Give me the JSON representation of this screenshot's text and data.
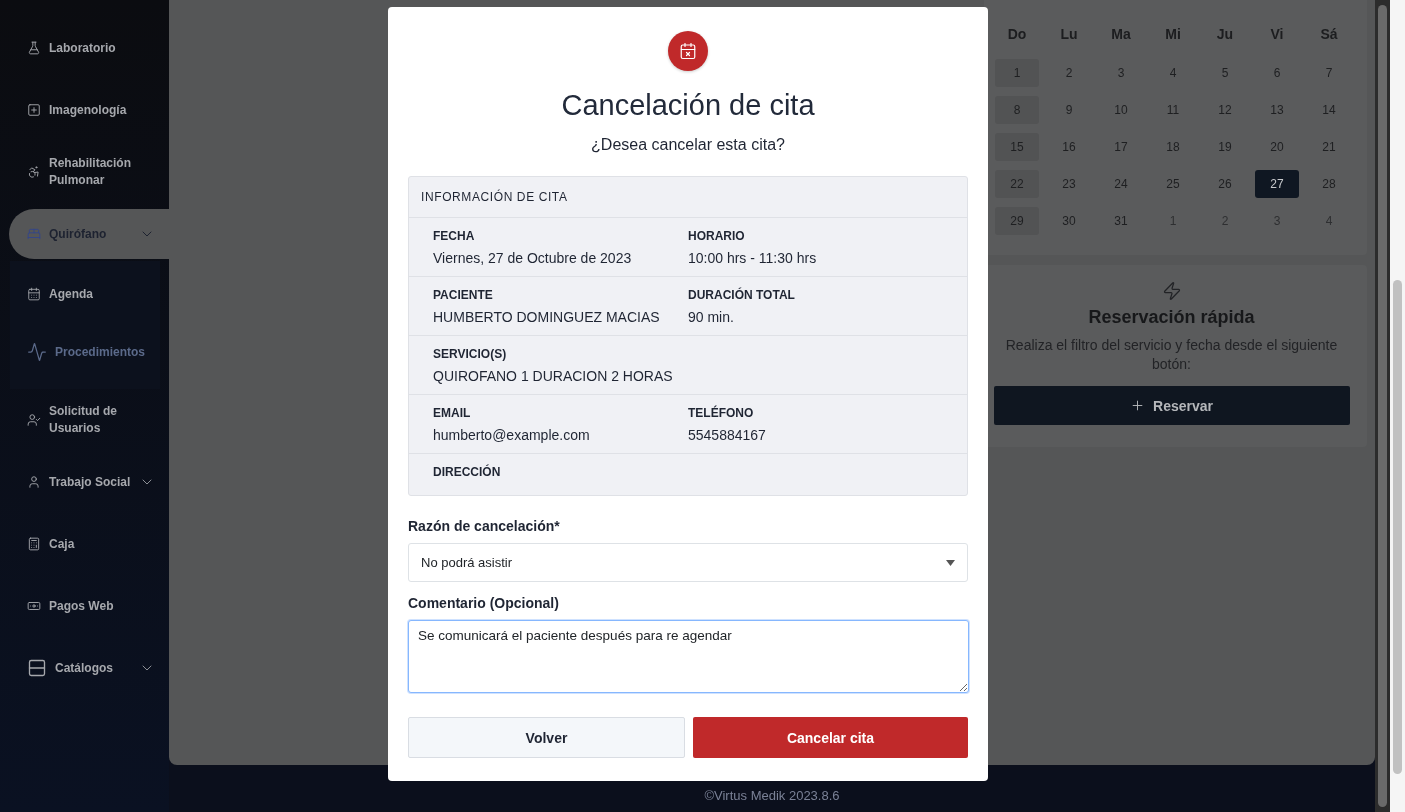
{
  "sidebar": {
    "items": [
      {
        "label": "Laboratorio",
        "selected": false
      },
      {
        "label": "Imagenología",
        "selected": false
      },
      {
        "label": "Rehabilitación Pulmonar",
        "selected": false
      },
      {
        "label": "Quirófano",
        "selected": true,
        "expanded": true,
        "children": [
          {
            "label": "Agenda",
            "selected": false
          },
          {
            "label": "Procedimientos",
            "selected": true
          }
        ]
      },
      {
        "label": "Solicitud de Usuarios",
        "selected": false
      },
      {
        "label": "Trabajo Social",
        "selected": false,
        "expanded": false
      },
      {
        "label": "Caja",
        "selected": false
      },
      {
        "label": "Pagos Web",
        "selected": false
      },
      {
        "label": "Catálogos",
        "selected": false,
        "expanded": false
      }
    ]
  },
  "calendar": {
    "weekdays": [
      "Do",
      "Lu",
      "Ma",
      "Mi",
      "Ju",
      "Vi",
      "Sá"
    ],
    "weeks": [
      [
        {
          "day": "1",
          "selected": false,
          "outside_month": false
        },
        {
          "day": "2",
          "selected": false,
          "outside_month": false
        },
        {
          "day": "3",
          "selected": false,
          "outside_month": false
        },
        {
          "day": "4",
          "selected": false,
          "outside_month": false
        },
        {
          "day": "5",
          "selected": false,
          "outside_month": false
        },
        {
          "day": "6",
          "selected": false,
          "outside_month": false
        },
        {
          "day": "7",
          "selected": false,
          "outside_month": false
        }
      ],
      [
        {
          "day": "8",
          "selected": false,
          "outside_month": false
        },
        {
          "day": "9",
          "selected": false,
          "outside_month": false
        },
        {
          "day": "10",
          "selected": false,
          "outside_month": false
        },
        {
          "day": "11",
          "selected": false,
          "outside_month": false
        },
        {
          "day": "12",
          "selected": false,
          "outside_month": false
        },
        {
          "day": "13",
          "selected": false,
          "outside_month": false
        },
        {
          "day": "14",
          "selected": false,
          "outside_month": false
        }
      ],
      [
        {
          "day": "15",
          "selected": false,
          "outside_month": false
        },
        {
          "day": "16",
          "selected": false,
          "outside_month": false
        },
        {
          "day": "17",
          "selected": false,
          "outside_month": false
        },
        {
          "day": "18",
          "selected": false,
          "outside_month": false
        },
        {
          "day": "19",
          "selected": false,
          "outside_month": false
        },
        {
          "day": "20",
          "selected": false,
          "outside_month": false
        },
        {
          "day": "21",
          "selected": false,
          "outside_month": false
        }
      ],
      [
        {
          "day": "22",
          "selected": false,
          "outside_month": false
        },
        {
          "day": "23",
          "selected": false,
          "outside_month": false
        },
        {
          "day": "24",
          "selected": false,
          "outside_month": false
        },
        {
          "day": "25",
          "selected": false,
          "outside_month": false
        },
        {
          "day": "26",
          "selected": false,
          "outside_month": false
        },
        {
          "day": "27",
          "selected": true,
          "outside_month": false
        },
        {
          "day": "28",
          "selected": false,
          "outside_month": false
        }
      ],
      [
        {
          "day": "29",
          "selected": false,
          "outside_month": false
        },
        {
          "day": "30",
          "selected": false,
          "outside_month": false
        },
        {
          "day": "31",
          "selected": false,
          "outside_month": false
        },
        {
          "day": "1",
          "selected": false,
          "outside_month": true
        },
        {
          "day": "2",
          "selected": false,
          "outside_month": true
        },
        {
          "day": "3",
          "selected": false,
          "outside_month": true
        },
        {
          "day": "4",
          "selected": false,
          "outside_month": true
        }
      ]
    ]
  },
  "quick_booking": {
    "title": "Reservación rápida",
    "text": "Realiza el filtro del servicio y fecha desde el siguiente botón:",
    "button": "Reservar"
  },
  "footer": {
    "text": "©Virtus Medik 2023.8.6"
  },
  "modal": {
    "title": "Cancelación de cita",
    "subtitle": "¿Desea cancelar esta cita?",
    "info": {
      "header": "INFORMACIÓN DE CITA",
      "rows": [
        {
          "fields": [
            {
              "label": "FECHA",
              "value": "Viernes, 27 de Octubre de 2023"
            },
            {
              "label": "HORARIO",
              "value": "10:00 hrs - 11:30 hrs"
            }
          ]
        },
        {
          "fields": [
            {
              "label": "PACIENTE",
              "value": "HUMBERTO DOMINGUEZ MACIAS"
            },
            {
              "label": "DURACIÓN TOTAL",
              "value": "90 min."
            }
          ]
        },
        {
          "fields": [
            {
              "label": "SERVICIO(S)",
              "value": "QUIROFANO 1 DURACION 2 HORAS"
            }
          ]
        },
        {
          "fields": [
            {
              "label": "EMAIL",
              "value": "humberto@example.com"
            },
            {
              "label": "TELÉFONO",
              "value": "5545884167"
            }
          ]
        },
        {
          "fields": [
            {
              "label": "DIRECCIÓN"
            }
          ]
        }
      ]
    },
    "reason": {
      "label": "Razón de cancelación*",
      "value": "No podrá asistir"
    },
    "comment": {
      "label": "Comentario (Opcional)",
      "value": "Se comunicará el paciente después para re agendar"
    },
    "buttons": [
      {
        "label": "Volver",
        "kind": "secondary"
      },
      {
        "label": "Cancelar cita",
        "kind": "danger"
      }
    ]
  }
}
